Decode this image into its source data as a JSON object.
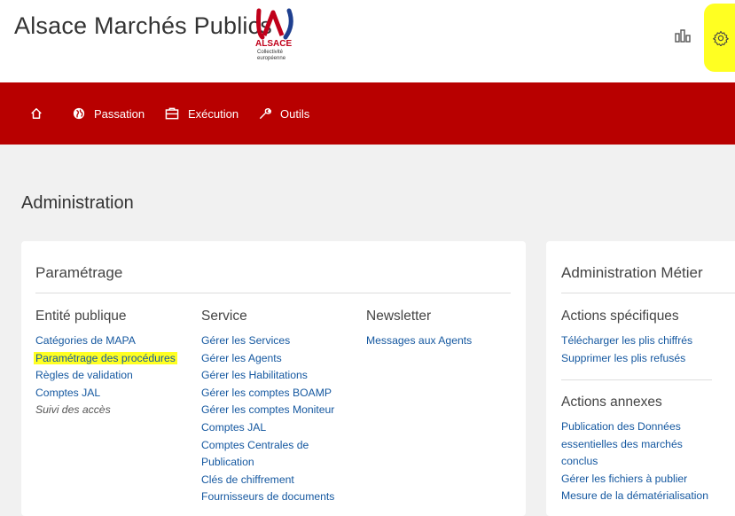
{
  "header": {
    "logo_text": "Alsace Marchés Publics",
    "badge_name": "ALSACE",
    "badge_sub1": "Collectivité",
    "badge_sub2": "européenne"
  },
  "nav": {
    "home": "",
    "passation": "Passation",
    "execution": "Exécution",
    "outils": "Outils"
  },
  "page": {
    "title": "Administration"
  },
  "parametrage": {
    "title": "Paramétrage",
    "entite": {
      "heading": "Entité publique",
      "items": [
        "Catégories de MAPA",
        "Paramétrage des procédures",
        "Règles de validation",
        "Comptes JAL",
        "Suivi des accès"
      ]
    },
    "service": {
      "heading": "Service",
      "items": [
        "Gérer les Services",
        "Gérer les Agents",
        "Gérer les Habilitations",
        "Gérer les comptes BOAMP",
        "Gérer les comptes Moniteur",
        "Comptes JAL",
        "Comptes Centrales de",
        "Publication",
        "Clés de chiffrement",
        "Fournisseurs de documents"
      ]
    },
    "newsletter": {
      "heading": "Newsletter",
      "items": [
        "Messages aux Agents"
      ]
    }
  },
  "metier": {
    "title": "Administration Métier",
    "specifiques": {
      "heading": "Actions spécifiques",
      "items": [
        "Télécharger les plis chiffrés",
        "Supprimer les plis refusés"
      ]
    },
    "annexes": {
      "heading": "Actions annexes",
      "items": [
        "Publication des Données",
        "essentielles des marchés",
        "conclus",
        "Gérer les fichiers à publier",
        "Mesure de la dématérialisation"
      ]
    }
  },
  "colors": {
    "nav_bg": "#b80000",
    "link": "#1558a0",
    "highlight": "#ffff22"
  },
  "icons": [
    "home-icon",
    "globe-icon",
    "briefcase-icon",
    "wrench-icon",
    "bar-chart-icon",
    "gear-icon"
  ]
}
